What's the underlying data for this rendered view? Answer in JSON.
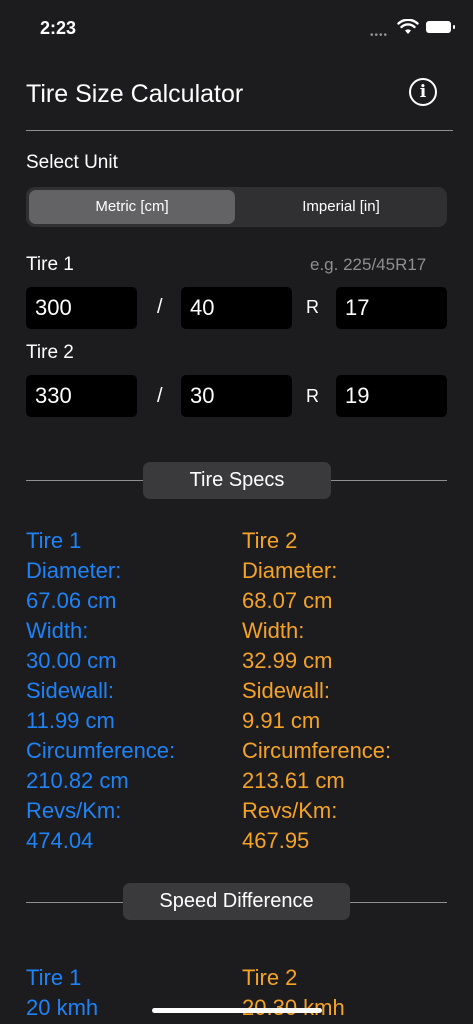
{
  "status": {
    "time": "2:23"
  },
  "header": {
    "title": "Tire Size Calculator",
    "info_icon": "i"
  },
  "unit": {
    "label": "Select Unit",
    "options": [
      "Metric [cm]",
      "Imperial [in]"
    ],
    "selected": "Metric [cm]"
  },
  "tire1": {
    "label": "Tire 1",
    "width": "300",
    "ratio": "40",
    "rim": "17"
  },
  "tire2": {
    "label": "Tire 2",
    "width": "330",
    "ratio": "30",
    "rim": "19"
  },
  "hint": "e.g. 225/45R17",
  "sep_slash": "/",
  "sep_r": "R",
  "specs": {
    "title": "Tire Specs",
    "tire1": {
      "label": "Tire 1",
      "diameter_label": "Diameter:",
      "diameter": "67.06 cm",
      "width_label": "Width:",
      "width": "30.00 cm",
      "sidewall_label": "Sidewall:",
      "sidewall": "11.99 cm",
      "circ_label": "Circumference:",
      "circ": "210.82 cm",
      "revs_label": "Revs/Km:",
      "revs": "474.04"
    },
    "tire2": {
      "label": "Tire 2",
      "diameter_label": "Diameter:",
      "diameter": "68.07 cm",
      "width_label": "Width:",
      "width": "32.99 cm",
      "sidewall_label": "Sidewall:",
      "sidewall": "9.91 cm",
      "circ_label": "Circumference:",
      "circ": "213.61 cm",
      "revs_label": "Revs/Km:",
      "revs": "467.95"
    }
  },
  "speed": {
    "title": "Speed Difference",
    "tire1": {
      "label": "Tire 1",
      "value": "20 kmh"
    },
    "tire2": {
      "label": "Tire 2",
      "value": "20.30 kmh"
    }
  },
  "colors": {
    "tire1": "#1f83f7",
    "tire2": "#f5a327",
    "background": "#1c1c1e"
  }
}
